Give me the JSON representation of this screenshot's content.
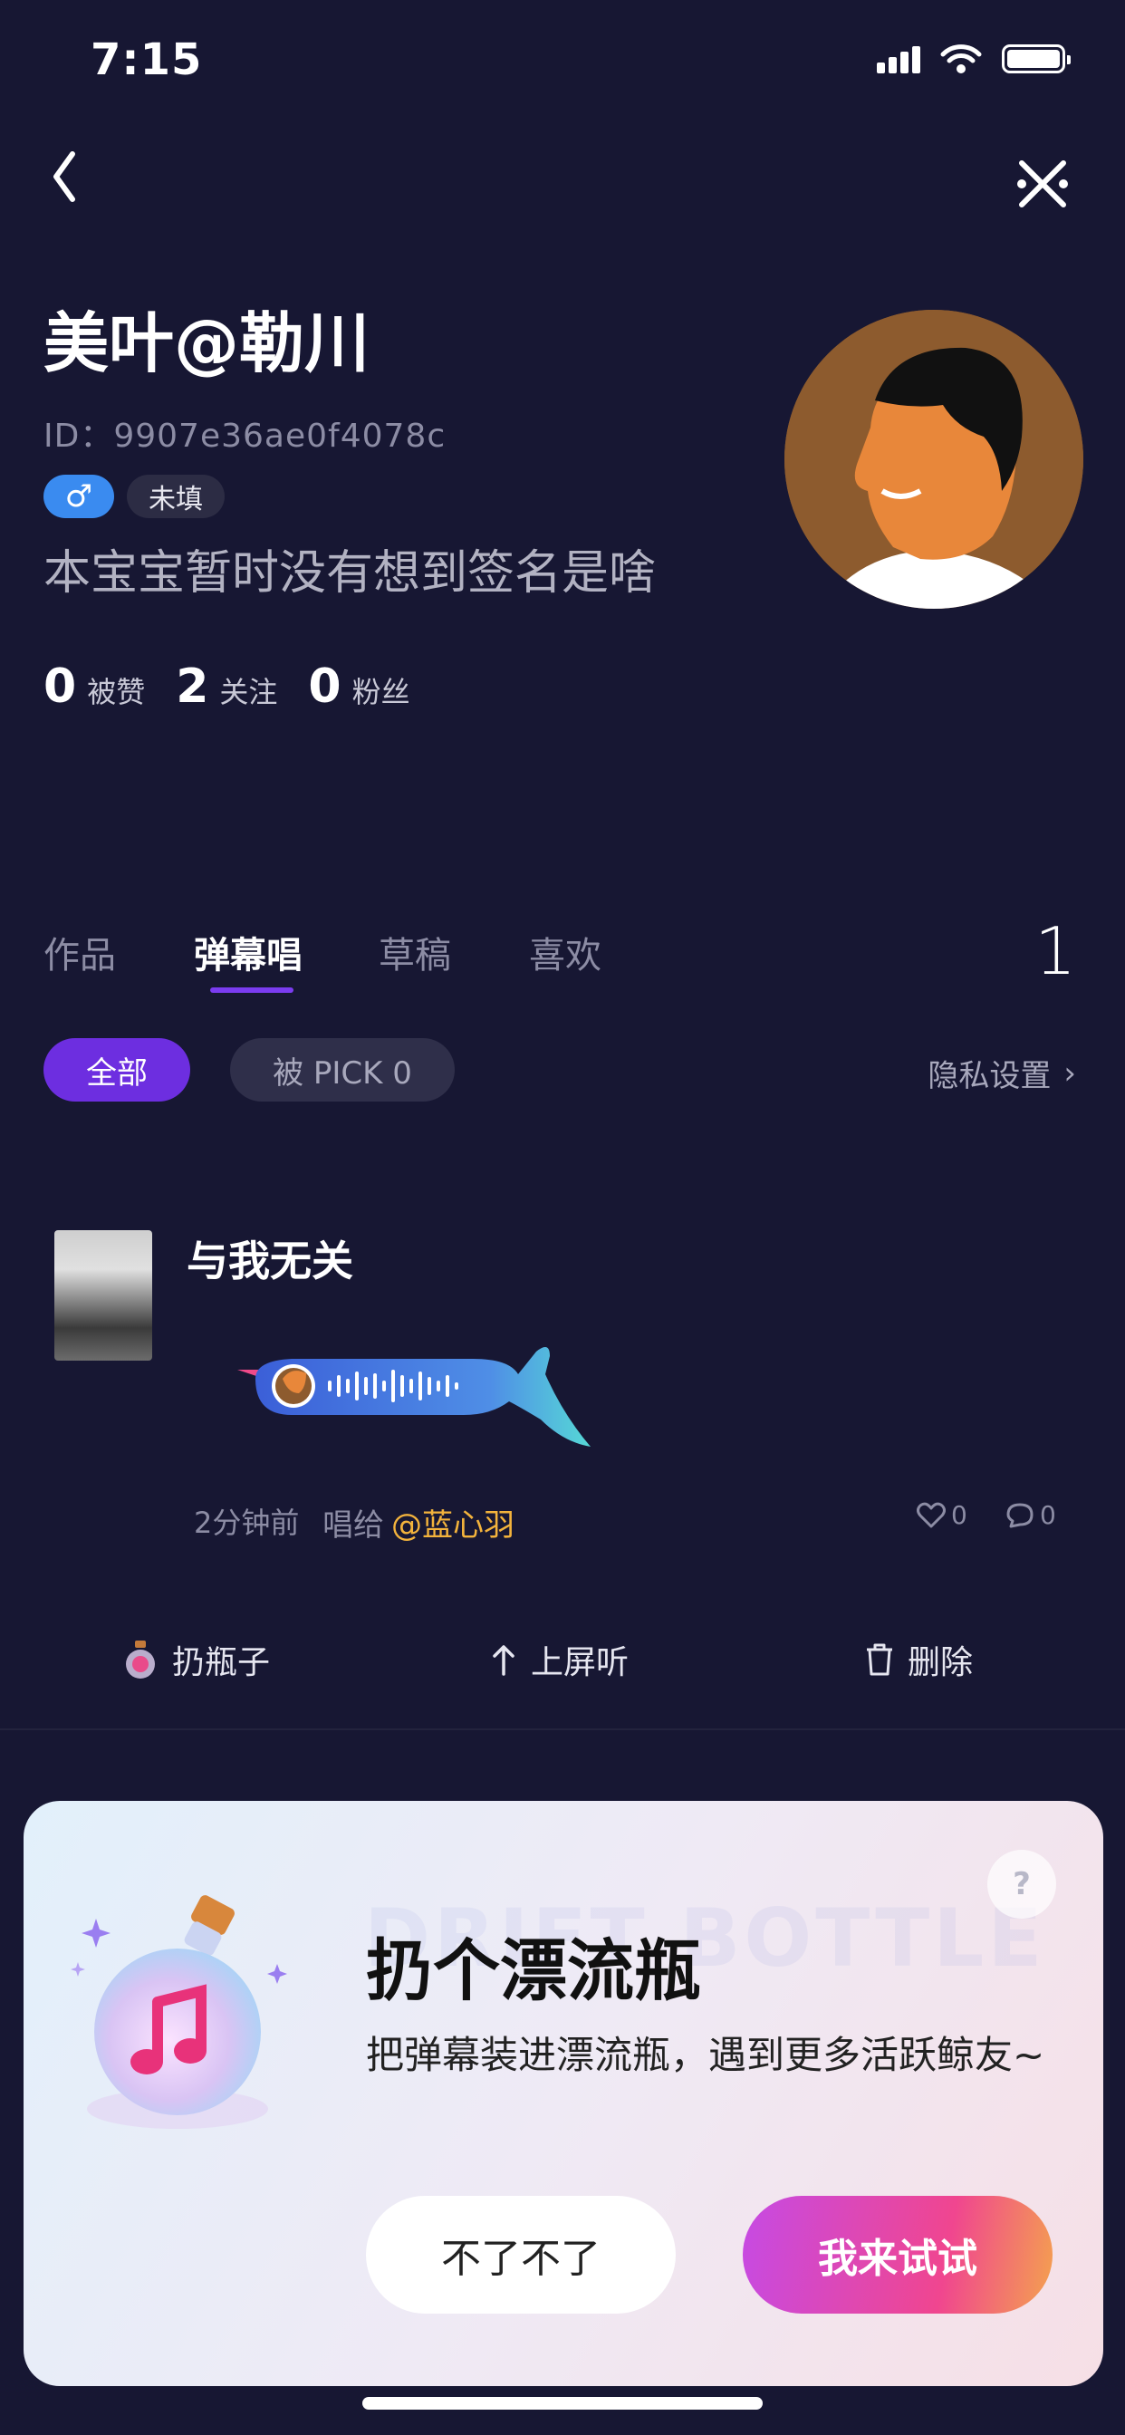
{
  "status_bar": {
    "time": "7:15"
  },
  "profile": {
    "name": "美叶@勒川",
    "id_label": "ID：9907e36ae0f4078c",
    "gender_symbol": "♂",
    "unfilled_tag": "未填",
    "signature": "本宝宝暂时没有想到签名是啥",
    "stats": [
      {
        "value": "0",
        "label": "被赞"
      },
      {
        "value": "2",
        "label": "关注"
      },
      {
        "value": "0",
        "label": "粉丝"
      }
    ]
  },
  "tabs": {
    "items": [
      "作品",
      "弹幕唱",
      "草稿",
      "喜欢"
    ],
    "active": "弹幕唱",
    "count": "1"
  },
  "filters": {
    "all": "全部",
    "pick": "被 PICK 0",
    "privacy": "隐私设置",
    "privacy_arrow": "›"
  },
  "item": {
    "title": "与我无关",
    "time": "2分钟前",
    "sang_to": "唱给",
    "mention": "@蓝心羽",
    "likes": "0",
    "comments": "0"
  },
  "actions": {
    "throw_bottle": "扔瓶子",
    "play_on_screen": "上屏听",
    "delete": "删除"
  },
  "dialog": {
    "help": "?",
    "watermark": "DRIFT BOTTLE",
    "title": "扔个漂流瓶",
    "description": "把弹幕装进漂流瓶，遇到更多活跃鲸友~",
    "decline": "不了不了",
    "accept": "我来试试"
  },
  "colors": {
    "background": "#171733",
    "accent": "#6d2ee0",
    "mention": "#f3b33c",
    "gender_blue": "#3a8bf0"
  }
}
